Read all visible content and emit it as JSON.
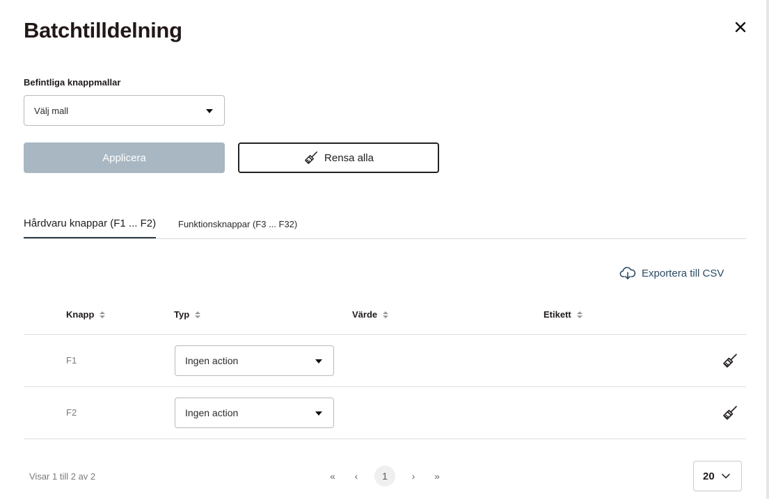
{
  "dialog": {
    "title": "Batchtilldelning",
    "close_icon": "close-icon"
  },
  "template": {
    "label": "Befintliga knappmallar",
    "selected": "Välj mall"
  },
  "actions": {
    "apply_label": "Applicera",
    "clear_all_label": "Rensa alla",
    "clear_icon": "broom-icon"
  },
  "tabs": [
    {
      "label": "Hårdvaru knappar (F1 ... F2)",
      "active": true
    },
    {
      "label": "Funktionsknappar (F3 ... F32)",
      "active": false
    }
  ],
  "export": {
    "label": "Exportera till CSV",
    "icon": "cloud-download-icon"
  },
  "table": {
    "columns": [
      "Knapp",
      "Typ",
      "Värde",
      "Etikett"
    ],
    "rows": [
      {
        "key": "F1",
        "type": "Ingen action",
        "value": "",
        "label": ""
      },
      {
        "key": "F2",
        "type": "Ingen action",
        "value": "",
        "label": ""
      }
    ]
  },
  "pagination": {
    "info": "Visar 1 till 2 av 2",
    "first": "«",
    "prev": "‹",
    "current_page": "1",
    "next": "›",
    "last": "»",
    "page_size": "20"
  },
  "colors": {
    "apply_disabled": "#a8b7c2",
    "accent": "#2b4a63",
    "tab_underline": "#2e3d47"
  }
}
